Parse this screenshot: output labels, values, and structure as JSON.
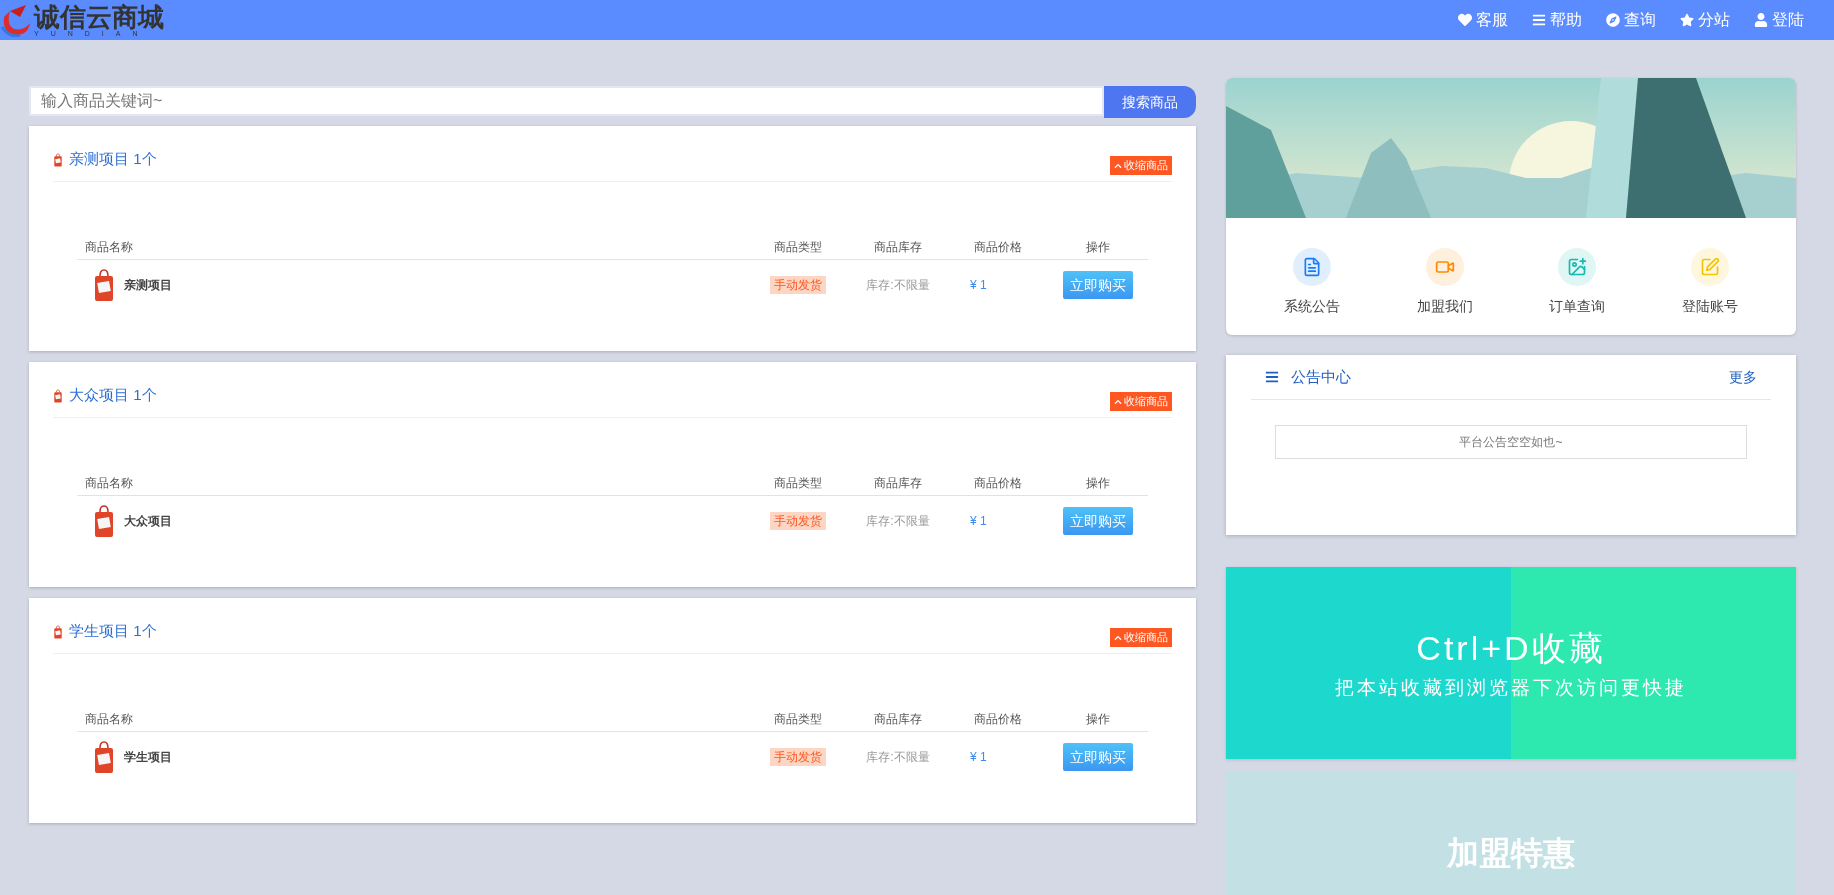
{
  "header": {
    "logo_text": "诚信云商城",
    "logo_subtext": "YUNDIAN",
    "nav": [
      {
        "kind": "heart",
        "label": "客服"
      },
      {
        "kind": "menu",
        "label": "帮助"
      },
      {
        "kind": "compass",
        "label": "查询"
      },
      {
        "kind": "star",
        "label": "分站"
      },
      {
        "kind": "user",
        "label": "登陆"
      }
    ]
  },
  "search": {
    "placeholder": "输入商品关键词~",
    "button": "搜索商品"
  },
  "categories": [
    {
      "title": "亲测项目",
      "count": "1个",
      "collapse": "收缩商品",
      "columns": [
        "商品名称",
        "商品类型",
        "商品库存",
        "商品价格",
        "操作"
      ],
      "rows": [
        {
          "name": "亲测项目",
          "type": "手动发货",
          "stock": "库存:不限量",
          "price": "¥ 1",
          "action": "立即购买"
        }
      ]
    },
    {
      "title": "大众项目",
      "count": "1个",
      "collapse": "收缩商品",
      "columns": [
        "商品名称",
        "商品类型",
        "商品库存",
        "商品价格",
        "操作"
      ],
      "rows": [
        {
          "name": "大众项目",
          "type": "手动发货",
          "stock": "库存:不限量",
          "price": "¥ 1",
          "action": "立即购买"
        }
      ]
    },
    {
      "title": "学生项目",
      "count": "1个",
      "collapse": "收缩商品",
      "columns": [
        "商品名称",
        "商品类型",
        "商品库存",
        "商品价格",
        "操作"
      ],
      "rows": [
        {
          "name": "学生项目",
          "type": "手动发货",
          "stock": "库存:不限量",
          "price": "¥ 1",
          "action": "立即购买"
        }
      ]
    }
  ],
  "quick_links": [
    {
      "kind": "document",
      "label": "系统公告",
      "color": "#1a7cf5"
    },
    {
      "kind": "video",
      "label": "加盟我们",
      "color": "#ff8a00"
    },
    {
      "kind": "order",
      "label": "订单查询",
      "color": "#17b8b0"
    },
    {
      "kind": "edit",
      "label": "登陆账号",
      "color": "#f5c400"
    }
  ],
  "notice": {
    "title": "公告中心",
    "more": "更多",
    "empty": "平台公告空空如也~"
  },
  "bookmark_banner": {
    "title": "Ctrl+D收藏",
    "subtitle": "把本站收藏到浏览器下次访问更快捷"
  },
  "join_banner": {
    "title": "加盟特惠"
  }
}
